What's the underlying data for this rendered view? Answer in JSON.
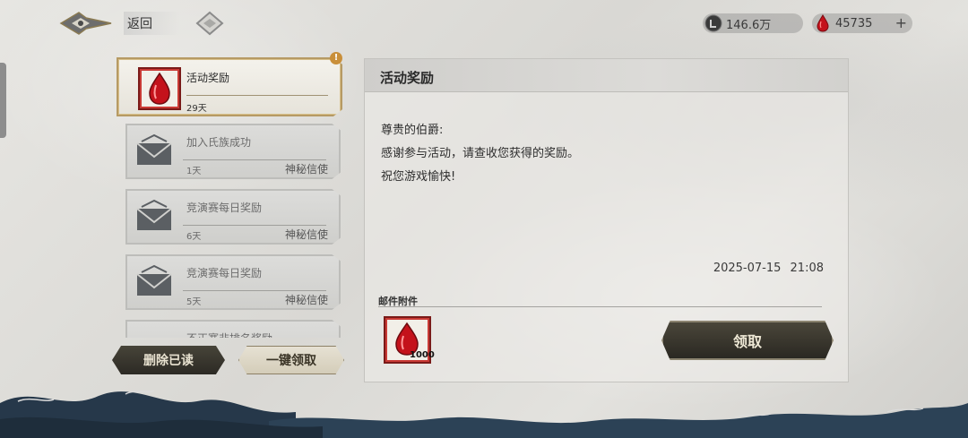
{
  "header": {
    "back_label": "返回",
    "silver_amount": "146.6万",
    "gem_amount": "45735",
    "plus_label": "+"
  },
  "mail_list": {
    "alert_badge": "!",
    "items": [
      {
        "title": "活动奖励",
        "days": "29天",
        "sender": "",
        "icon": "red-gem-icon",
        "selected": true
      },
      {
        "title": "加入氏族成功",
        "days": "1天",
        "sender": "神秘信使",
        "icon": "envelope-icon",
        "selected": false
      },
      {
        "title": "竞演赛每日奖励",
        "days": "6天",
        "sender": "神秘信使",
        "icon": "envelope-icon",
        "selected": false
      },
      {
        "title": "竞演赛每日奖励",
        "days": "5天",
        "sender": "神秘信使",
        "icon": "envelope-icon",
        "selected": false
      },
      {
        "title": "不正赛非排名奖励",
        "days": "",
        "sender": "",
        "icon": "envelope-icon",
        "selected": false
      }
    ],
    "delete_read_label": "删除已读",
    "claim_all_label": "一键领取"
  },
  "detail": {
    "title": "活动奖励",
    "greeting": "尊贵的伯爵:",
    "line1": "感谢参与活动，请查收您获得的奖励。",
    "line2": "祝您游戏愉快!",
    "date": "2025-07-15",
    "time": "21:08",
    "attachments_label": "邮件附件",
    "attachment_quantity": "1000",
    "claim_label": "领取"
  },
  "colors": {
    "gold_frame": "#b69a64",
    "gem_red": "#c4121b",
    "dark_button": "#2c2a24",
    "wave_blue": "#26384a"
  }
}
